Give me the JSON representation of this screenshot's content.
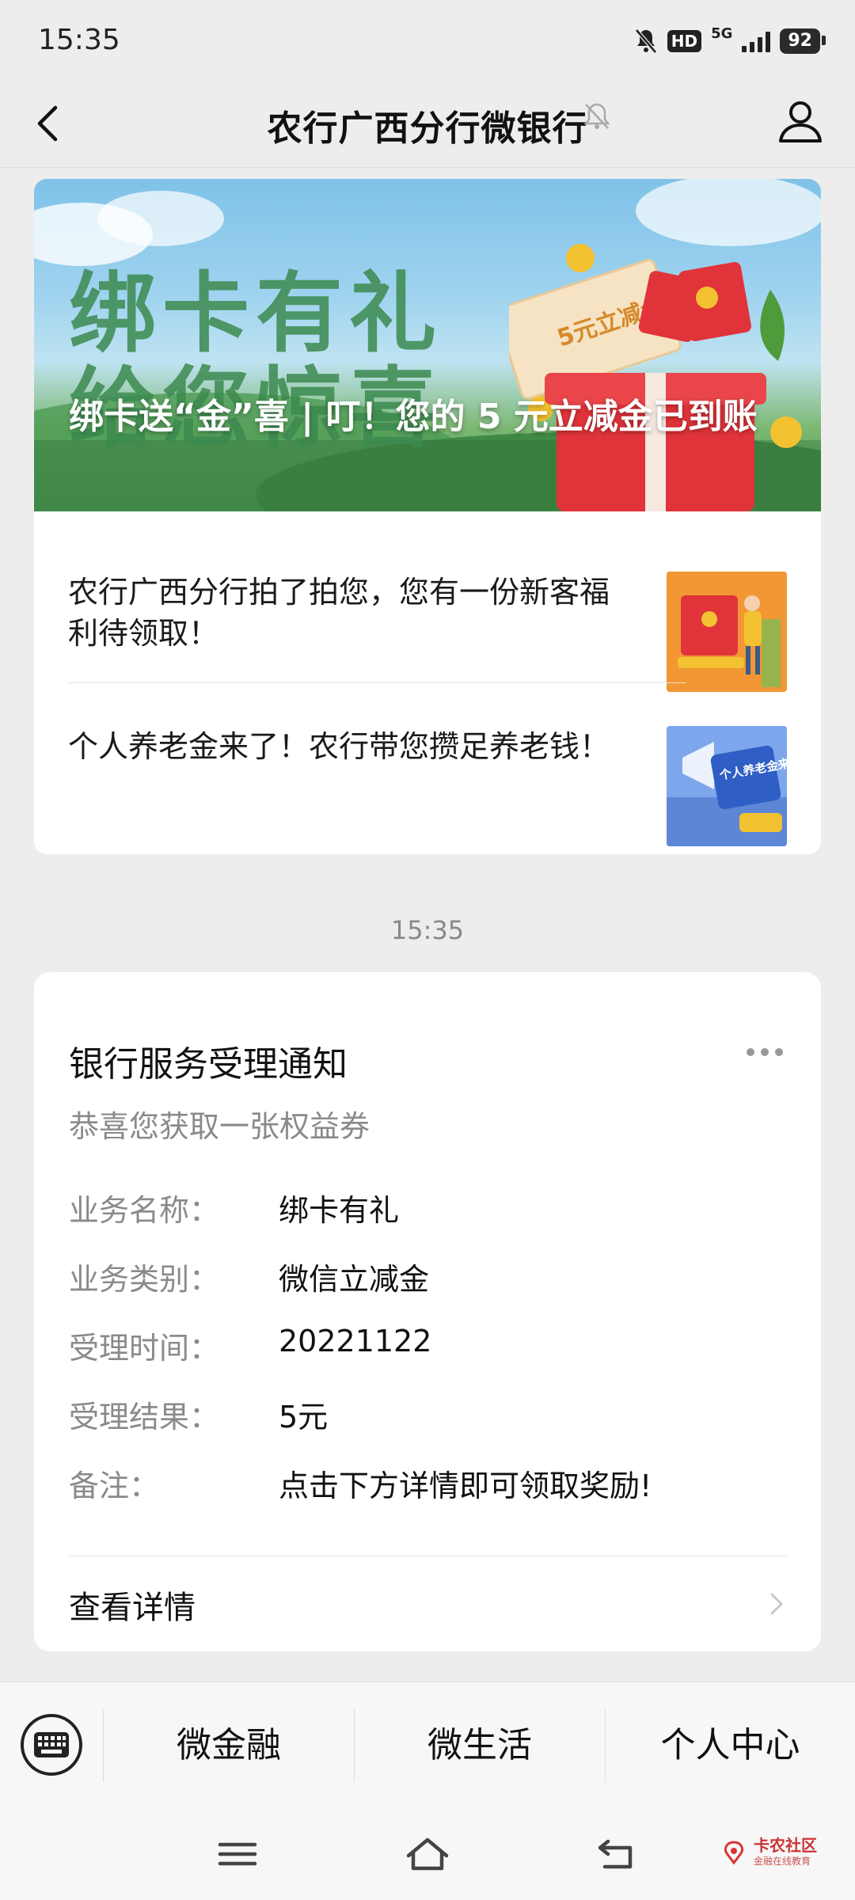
{
  "status_bar": {
    "time": "15:35",
    "hd_label": "HD",
    "network_label": "5G",
    "battery": "92"
  },
  "nav": {
    "title": "农行广西分行微银行"
  },
  "article": {
    "banner_title_line1": "绑卡有礼",
    "banner_title_line2": "给您惊喜",
    "banner_caption": "绑卡送“金”喜 | 叮！您的 5 元立减金已到账",
    "coupon_text": "5元立减金",
    "items": [
      {
        "text": "农行广西分行拍了拍您，您有一份新客福利待领取！",
        "thumb_text": ""
      },
      {
        "text": "个人养老金来了！农行带您攒足养老钱！",
        "thumb_text": "个人养老金来了!"
      }
    ]
  },
  "timestamp": "15:35",
  "notice": {
    "title": "银行服务受理通知",
    "subtitle": "恭喜您获取一张权益券",
    "rows": [
      {
        "key": "业务名称：",
        "value": "绑卡有礼"
      },
      {
        "key": "业务类别：",
        "value": "微信立减金"
      },
      {
        "key": "受理时间：",
        "value": "20221122"
      },
      {
        "key": "受理结果：",
        "value": "5元"
      },
      {
        "key": "备注：",
        "value": "点击下方详情即可领取奖励!"
      }
    ],
    "detail_label": "查看详情"
  },
  "bottom_menu": {
    "items": [
      "微金融",
      "微生活",
      "个人中心"
    ]
  },
  "watermark": {
    "text": "卡农社区",
    "sub": "金融在线教育"
  },
  "colors": {
    "page_bg": "#ededed",
    "card_bg": "#ffffff",
    "muted_text": "#8a8a8a",
    "banner_green": "#3c8a4f",
    "gift_red": "#e0343a"
  },
  "icons": {
    "back": "chevron-left-icon",
    "mute": "bell-off-icon",
    "user": "user-icon",
    "more": "more-dots-icon",
    "keyboard": "keyboard-icon",
    "detail": "chevron-right-icon"
  }
}
